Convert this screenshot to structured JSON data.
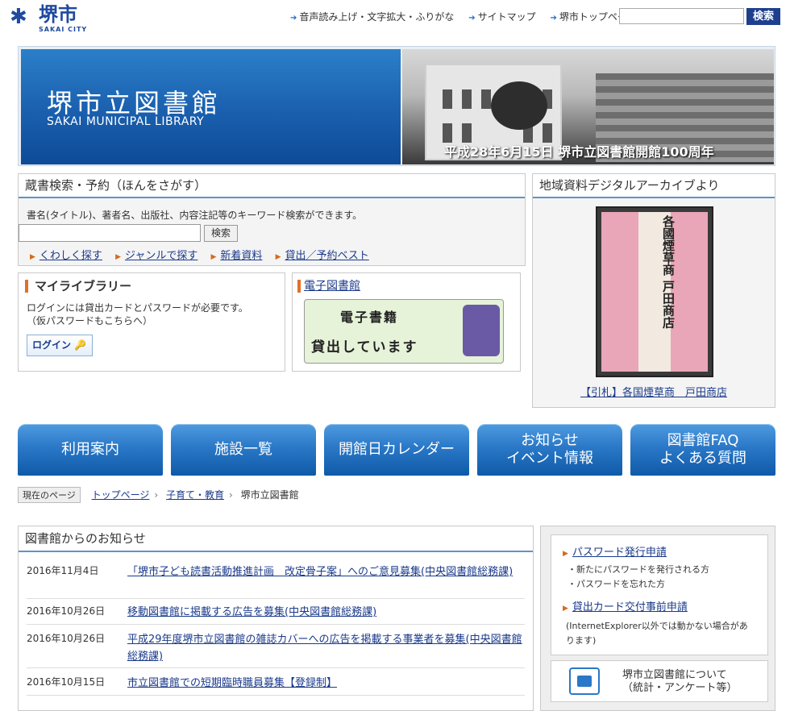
{
  "header": {
    "logo_name": "堺市",
    "logo_en": "SAKAI CITY",
    "top_links": [
      "音声読み上げ・文字拡大・ふりがな",
      "サイトマップ",
      "堺市トップページ"
    ],
    "search_label": "検索"
  },
  "banner": {
    "title": "堺市立図書館",
    "subtitle": "SAKAI MUNICIPAL LIBRARY",
    "caption": "平成28年6月15日 堺市立図書館開館100周年"
  },
  "catalog": {
    "title": "蔵書検索・予約（ほんをさがす）",
    "description": "書名(タイトル)、著者名、出版社、内容注記等のキーワード検索ができます。",
    "search_button": "検索",
    "links": [
      "くわしく探す",
      "ジャンルで探す",
      "新着資料",
      "貸出／予約ベスト"
    ]
  },
  "mylibrary": {
    "title": "マイライブラリー",
    "line1": "ログインには貸出カードとパスワードが必要です。",
    "line2": "（仮パスワードもこちらへ）",
    "login_button": "ログイン"
  },
  "ebook": {
    "title": "電子図書館",
    "banner_row1": "　　電子書籍",
    "banner_row2": "貸出しています"
  },
  "archive": {
    "title": "地域資料デジタルアーカイブより",
    "poster_text": "各國煙草商 戸田商店",
    "caption": "【引札】各国煙草商　戸田商店"
  },
  "nav": [
    "利用案内",
    "施設一覧",
    "開館日カレンダー",
    "お知らせ\nイベント情報",
    "図書館FAQ\nよくある質問"
  ],
  "breadcrumb": {
    "current_label": "現在のページ",
    "items": [
      "トップページ",
      "子育て・教育",
      "堺市立図書館"
    ]
  },
  "news": {
    "title": "図書館からのお知らせ",
    "items": [
      {
        "date": "2016年11月4日",
        "text": "「堺市子ども読書活動推進計画　改定骨子案」へのご意見募集(中央図書館総務課)"
      },
      {
        "date": "2016年10月26日",
        "text": "移動図書館に掲載する広告を募集(中央図書館総務課)"
      },
      {
        "date": "2016年10月26日",
        "text": "平成29年度堺市立図書館の雑誌カバーへの広告を掲載する事業者を募集(中央図書館総務課)"
      },
      {
        "date": "2016年10月15日",
        "text": "市立図書館での短期臨時職員募集【登録制】"
      }
    ]
  },
  "side": {
    "link1": "パスワード発行申請",
    "link1_sub1": "・新たにパスワードを発行される方",
    "link1_sub2": "・パスワードを忘れた方",
    "link2": "貸出カード交付事前申請",
    "link2_sub1": "(InternetExplorer以外では動かない場合があ",
    "link2_sub2": "ります)",
    "about_line1": "堺市立図書館について",
    "about_line2": "（統計・アンケート等）"
  },
  "colors": {
    "accent": "#1e3f8e",
    "nav_button": "#2a78c7",
    "marker": "#e0702a"
  }
}
